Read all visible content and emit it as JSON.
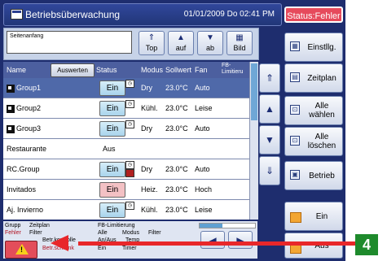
{
  "window": {
    "title": "Betriebsüberwachung",
    "datetime": "01/01/2009 Do 02:41 PM",
    "status_button": "Status:Fehler"
  },
  "nav": {
    "search_value": "Seitenanfang",
    "top": "Top",
    "auf": "auf",
    "ab": "ab",
    "bild": "Bild",
    "icons": {
      "top": "double-up-arrow-icon",
      "auf": "up-arrow-icon",
      "ab": "down-arrow-icon",
      "bild": "grid-icon"
    }
  },
  "table": {
    "headers": {
      "name": "Name",
      "auswerten": "Auswerten",
      "status": "Status",
      "modus": "Modus",
      "sollwert": "Sollwert",
      "fan": "Fan",
      "fb": "FB-\nLimitieru"
    },
    "rows": [
      {
        "name": "Group1",
        "group_icon": true,
        "status": "Ein",
        "modus": "Dry",
        "sollwert": "23.0°C",
        "fan": "Auto",
        "selected": true
      },
      {
        "name": "Group2",
        "group_icon": true,
        "status": "Ein",
        "modus": "Kühl.",
        "sollwert": "23.0°C",
        "fan": "Leise"
      },
      {
        "name": "Group3",
        "group_icon": true,
        "status": "Ein",
        "modus": "Dry",
        "sollwert": "23.0°C",
        "fan": "Auto"
      },
      {
        "name": "Restaurante",
        "status": "Aus",
        "modus": "",
        "sollwert": "",
        "fan": ""
      },
      {
        "name": "RC.Group",
        "status": "Ein",
        "modus": "Dry",
        "sollwert": "23.0°C",
        "fan": "Auto",
        "error": true
      },
      {
        "name": "Invitados",
        "status": "Ein",
        "modus": "Heiz.",
        "sollwert": "23.0°C",
        "fan": "Hoch",
        "red_status": true
      },
      {
        "name": "Aj. Invierno",
        "status": "Ein",
        "modus": "Kühl.",
        "sollwert": "23.0°C",
        "fan": "Leise"
      }
    ]
  },
  "legend": {
    "grupp": "Grupp",
    "zeitplan": "Zeitplan",
    "fehler": "Fehler",
    "filter": "Filter",
    "betr_kontrolle": "Betr.kontrolle",
    "betr_schrank": "Betr.schrank",
    "fb_limit": "FB-Limitierung",
    "alle": "Alle",
    "modus": "Modus",
    "filter2": "Filter",
    "an_aus": "An/Aus",
    "temp": "Temp",
    "ein": "Ein",
    "timer": "Timer"
  },
  "sidebar": {
    "einstellg": "Einstllg.",
    "zeitplan": "Zeitplan",
    "alle_waehlen": "Alle\nwählen",
    "alle_loeschen": "Alle\nlöschen",
    "betrieb": "Betrieb",
    "ein": "Ein",
    "aus": "Aus"
  },
  "callout": {
    "number": "4"
  },
  "colors": {
    "accent_blue": "#1e2d6e",
    "selected_row": "#4f69a9",
    "error_red": "#e64a5c",
    "callout_red": "#e8272a",
    "callout_green": "#1e8a2c"
  }
}
